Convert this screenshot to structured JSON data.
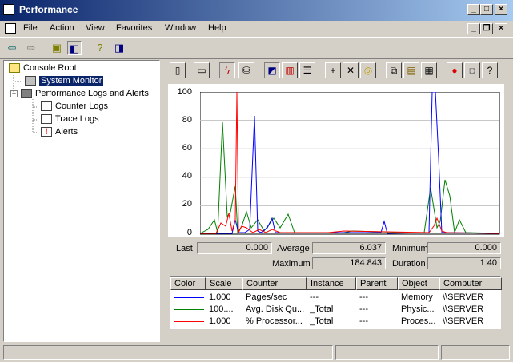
{
  "window": {
    "title": "Performance"
  },
  "menu": [
    "File",
    "Action",
    "View",
    "Favorites",
    "Window",
    "Help"
  ],
  "tree": {
    "root": "Console Root",
    "system_monitor": "System Monitor",
    "perf_logs": "Performance Logs and Alerts",
    "counter_logs": "Counter Logs",
    "trace_logs": "Trace Logs",
    "alerts": "Alerts"
  },
  "graph": {
    "y_ticks": [
      "100",
      "80",
      "60",
      "40",
      "20",
      "0"
    ],
    "colors": {
      "pages": "#0000ff",
      "disk": "#008000",
      "proc": "#ff0000"
    }
  },
  "stats": {
    "last_label": "Last",
    "last_value": "0.000",
    "average_label": "Average",
    "average_value": "6.037",
    "minimum_label": "Minimum",
    "minimum_value": "0.000",
    "maximum_label": "Maximum",
    "maximum_value": "184.843",
    "duration_label": "Duration",
    "duration_value": "1:40"
  },
  "legend": {
    "headers": [
      "Color",
      "Scale",
      "Counter",
      "Instance",
      "Parent",
      "Object",
      "Computer"
    ],
    "rows": [
      {
        "color": "#0000ff",
        "scale": "1.000",
        "counter": "Pages/sec",
        "instance": "---",
        "parent": "---",
        "object": "Memory",
        "computer": "\\\\SERVER"
      },
      {
        "color": "#008000",
        "scale": "100....",
        "counter": "Avg. Disk Qu...",
        "instance": "_Total",
        "parent": "---",
        "object": "Physic...",
        "computer": "\\\\SERVER"
      },
      {
        "color": "#ff0000",
        "scale": "1.000",
        "counter": "% Processor...",
        "instance": "_Total",
        "parent": "---",
        "object": "Proces...",
        "computer": "\\\\SERVER"
      }
    ]
  }
}
